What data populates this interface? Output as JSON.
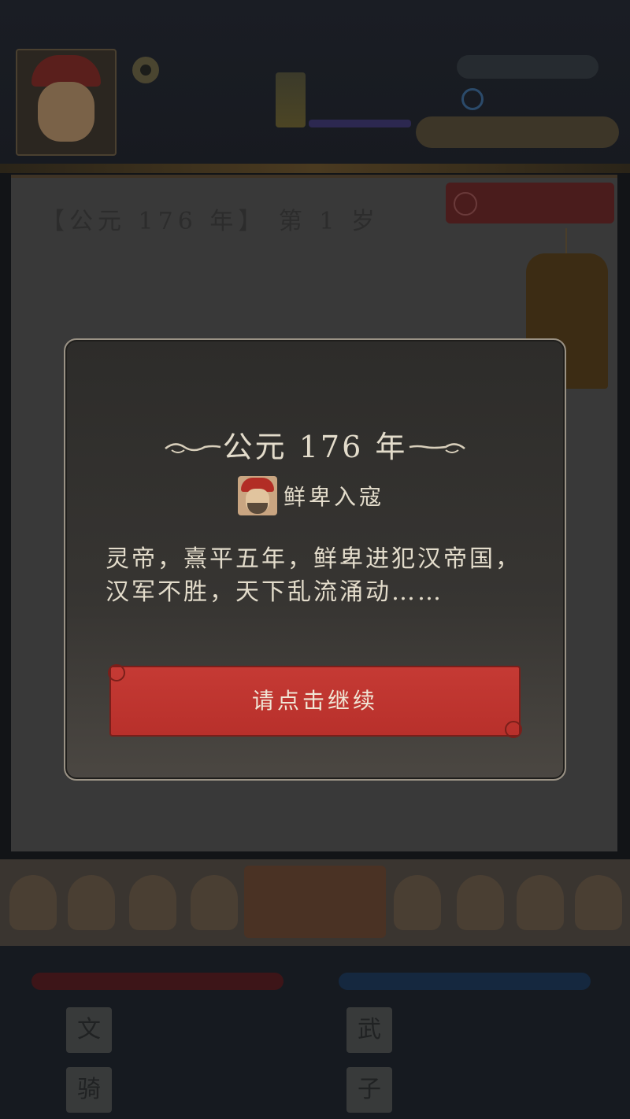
{
  "background": {
    "year_header": "【公元 176 年】 第 1 岁",
    "stat_buttons": [
      "文",
      "武",
      "骑",
      "子"
    ]
  },
  "dialog": {
    "title": "公元 176 年",
    "event_icon": "event-portrait-icon",
    "event_title": "鲜卑入寇",
    "description": "灵帝，熹平五年，鲜卑进犯汉帝国，汉军不胜，天下乱流涌动……",
    "continue_label": "请点击继续"
  },
  "colors": {
    "dialog_text": "#e3dccb",
    "button_red": "#c53a34",
    "dialog_border": "#9a9285"
  }
}
